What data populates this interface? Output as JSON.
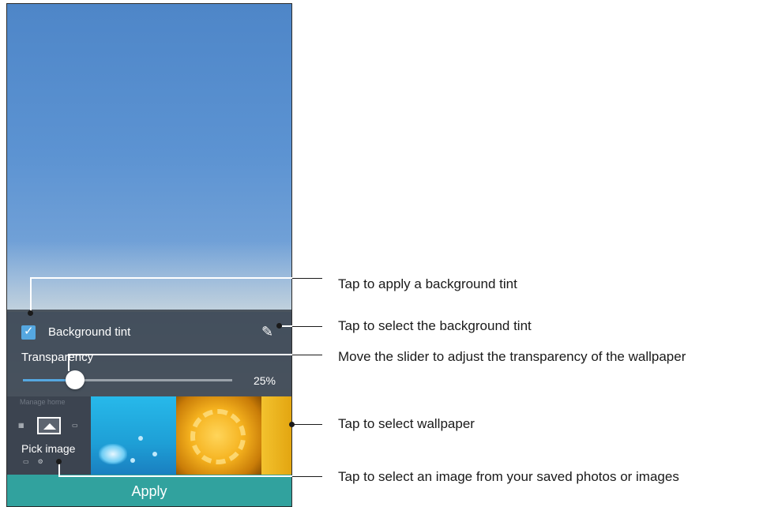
{
  "screen": {
    "background_tint_label": "Background tint",
    "background_tint_checked": true,
    "transparency_label": "Transparency",
    "transparency_value": 25,
    "transparency_display": "25%",
    "wallpaper_header": "Manage home",
    "pick_image_label": "Pick image",
    "apply_label": "Apply",
    "colors": {
      "accent": "#55a7e0",
      "apply_bar": "#31a29e",
      "panel": "#3a424c"
    },
    "icons": {
      "checkbox": "check-icon",
      "tint_edit": "pencil-icon",
      "pick_image": "gallery-icon"
    }
  },
  "callouts": [
    {
      "text": "Tap to apply a background tint"
    },
    {
      "text": "Tap to select the background tint"
    },
    {
      "text": "Move the slider to adjust the transparency of the wallpaper"
    },
    {
      "text": "Tap to select wallpaper"
    },
    {
      "text": "Tap to select an image from your saved photos or images"
    }
  ]
}
